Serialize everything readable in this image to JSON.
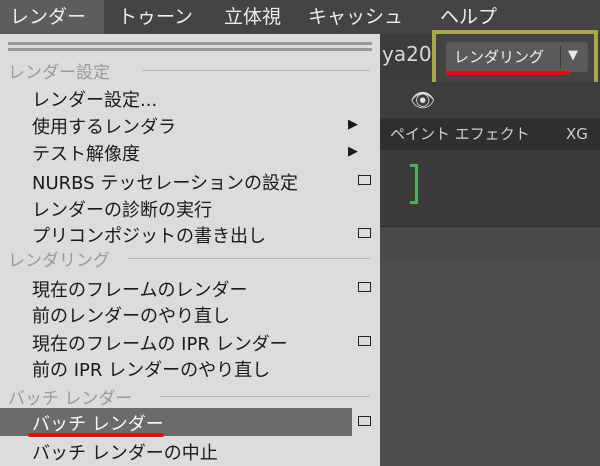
{
  "menubar": {
    "items": [
      "レンダー",
      "トゥーン",
      "立体視",
      "キャッシュ",
      "ヘルプ"
    ]
  },
  "background": {
    "window_title": "ya20",
    "render_mode_dropdown": "レンダリング",
    "tabs": [
      "ペイント エフェクト",
      "XG"
    ]
  },
  "menu": {
    "sections": [
      {
        "title": "レンダー設定",
        "items": [
          {
            "label": "レンダー設定...",
            "submenu": false,
            "option_box": false
          },
          {
            "label": "使用するレンダラ",
            "submenu": true,
            "option_box": false
          },
          {
            "label": "テスト解像度",
            "submenu": true,
            "option_box": false
          },
          {
            "label": "NURBS テッセレーションの設定",
            "submenu": false,
            "option_box": true
          },
          {
            "label": "レンダーの診断の実行",
            "submenu": false,
            "option_box": false
          },
          {
            "label": "プリコンポジットの書き出し",
            "submenu": false,
            "option_box": true
          }
        ]
      },
      {
        "title": "レンダリング",
        "items": [
          {
            "label": "現在のフレームのレンダー",
            "submenu": false,
            "option_box": true
          },
          {
            "label": "前のレンダーのやり直し",
            "submenu": false,
            "option_box": false
          },
          {
            "label": "現在のフレームの IPR レンダー",
            "submenu": false,
            "option_box": true
          },
          {
            "label": "前の IPR レンダーのやり直し",
            "submenu": false,
            "option_box": false
          }
        ]
      },
      {
        "title": "バッチ レンダー",
        "items": [
          {
            "label": "バッチ レンダー",
            "submenu": false,
            "option_box": true,
            "highlighted": true
          },
          {
            "label": "バッチ レンダーの中止",
            "submenu": false,
            "option_box": false
          }
        ]
      }
    ]
  },
  "colors": {
    "menu_bg": "#dcdcdc",
    "highlight": "#6b6b6b",
    "annotation_red": "#e0101a",
    "annotation_frame": "#a8a84a"
  }
}
